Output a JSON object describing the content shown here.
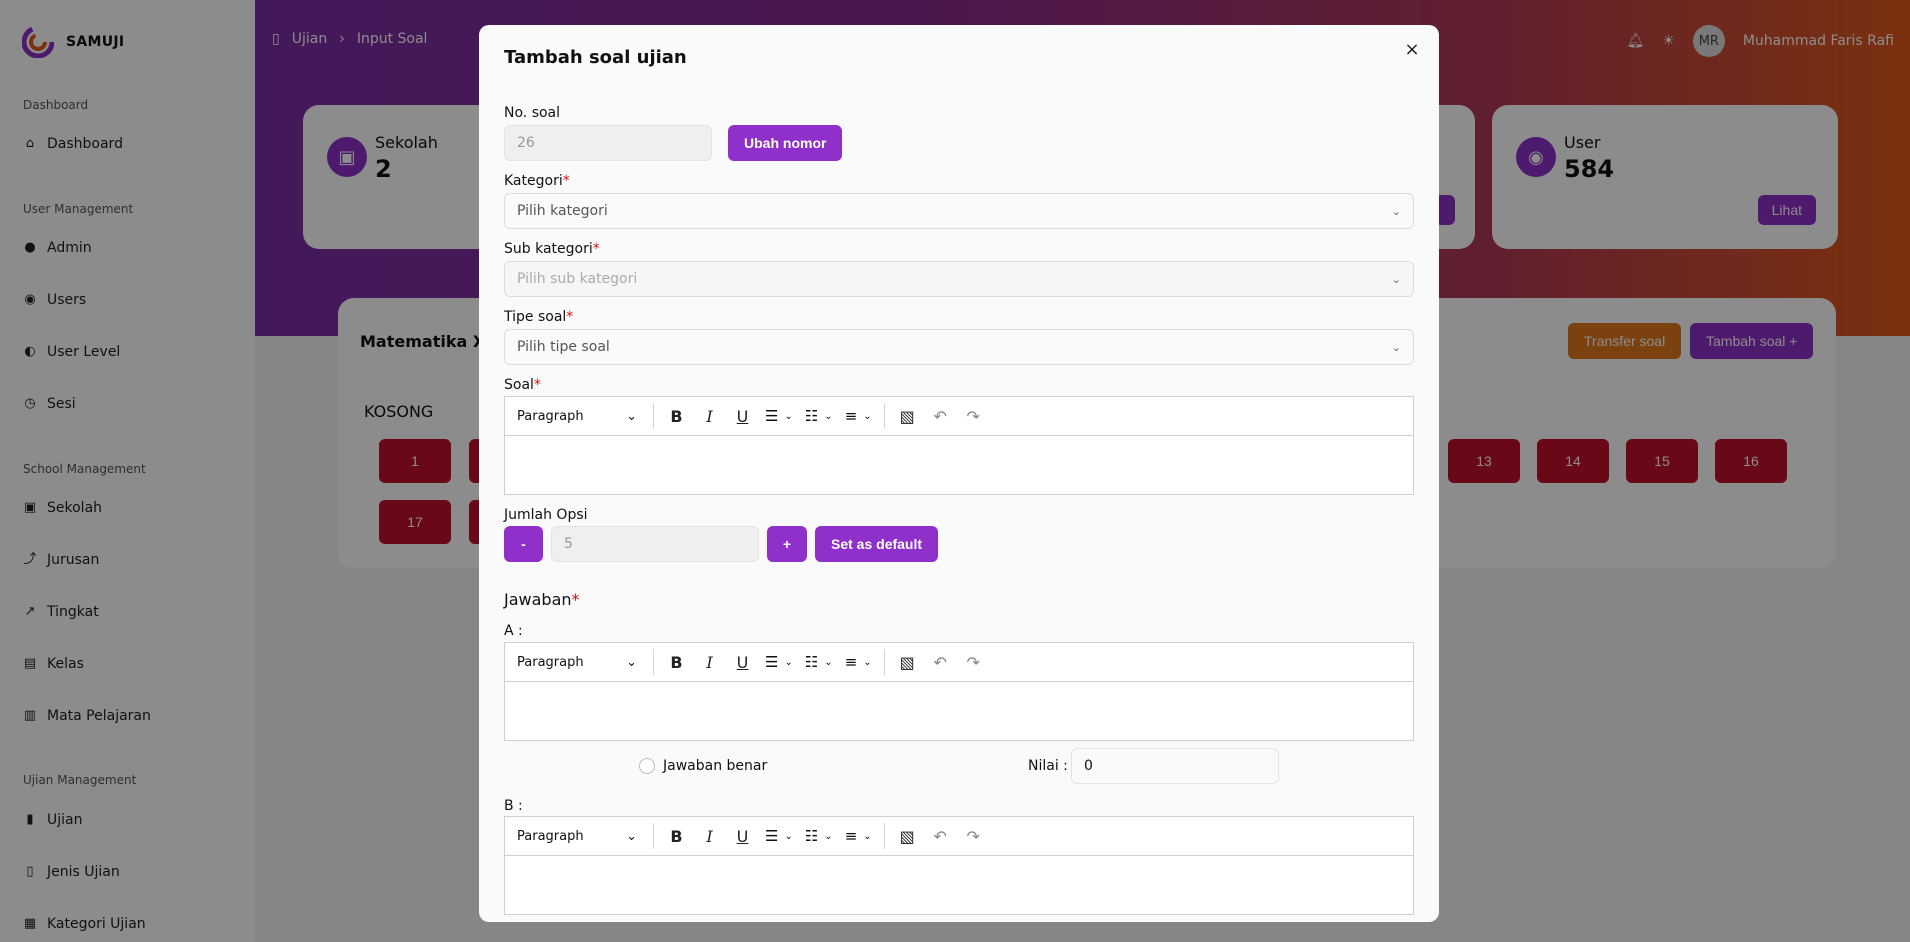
{
  "app": {
    "name": "SAMUJI"
  },
  "sidebar": {
    "sections": [
      {
        "title": "Dashboard",
        "items": [
          {
            "label": "Dashboard"
          }
        ]
      },
      {
        "title": "User Management",
        "items": [
          {
            "label": "Admin"
          },
          {
            "label": "Users"
          },
          {
            "label": "User Level"
          },
          {
            "label": "Sesi"
          }
        ]
      },
      {
        "title": "School Management",
        "items": [
          {
            "label": "Sekolah"
          },
          {
            "label": "Jurusan"
          },
          {
            "label": "Tingkat"
          },
          {
            "label": "Kelas"
          },
          {
            "label": "Mata Pelajaran"
          }
        ]
      },
      {
        "title": "Ujian Management",
        "items": [
          {
            "label": "Ujian"
          },
          {
            "label": "Jenis Ujian"
          },
          {
            "label": "Kategori Ujian"
          }
        ]
      }
    ]
  },
  "header": {
    "breadcrumb": [
      "Ujian",
      "Input Soal"
    ],
    "user_initials": "MR",
    "user_name": "Muhammad Faris Rafi"
  },
  "stats": [
    {
      "label": "Sekolah",
      "value": "2"
    },
    {
      "label": "User",
      "value": "584",
      "button": "Lihat"
    }
  ],
  "exam": {
    "title": "Matematika XI",
    "status": "KOSONG",
    "transfer_label": "Transfer soal",
    "add_label": "Tambah soal +",
    "numbers_row1_left": [
      "1"
    ],
    "numbers_row1_right": [
      "13",
      "14",
      "15",
      "16"
    ],
    "numbers_row2_left": [
      "17"
    ]
  },
  "modal": {
    "title": "Tambah soal ujian",
    "close": "×",
    "no_soal": {
      "label": "No. soal",
      "value": "26",
      "button": "Ubah nomor"
    },
    "kategori": {
      "label": "Kategori",
      "placeholder": "Pilih kategori"
    },
    "sub_kategori": {
      "label": "Sub kategori",
      "placeholder": "Pilih sub kategori"
    },
    "tipe_soal": {
      "label": "Tipe soal",
      "placeholder": "Pilih tipe soal"
    },
    "soal": {
      "label": "Soal"
    },
    "jumlah_opsi": {
      "label": "Jumlah Opsi",
      "minus": "-",
      "value": "5",
      "plus": "+",
      "default_button": "Set as default"
    },
    "jawaban": {
      "label": "Jawaban"
    },
    "options": [
      {
        "letter": "A :",
        "correct_label": "Jawaban benar",
        "nilai_label": "Nilai :",
        "nilai_value": "0"
      },
      {
        "letter": "B :"
      }
    ],
    "editor": {
      "paragraph": "Paragraph"
    }
  },
  "colors": {
    "accent": "#8e30c9",
    "danger": "#c0112b",
    "warning": "#e0771d"
  }
}
